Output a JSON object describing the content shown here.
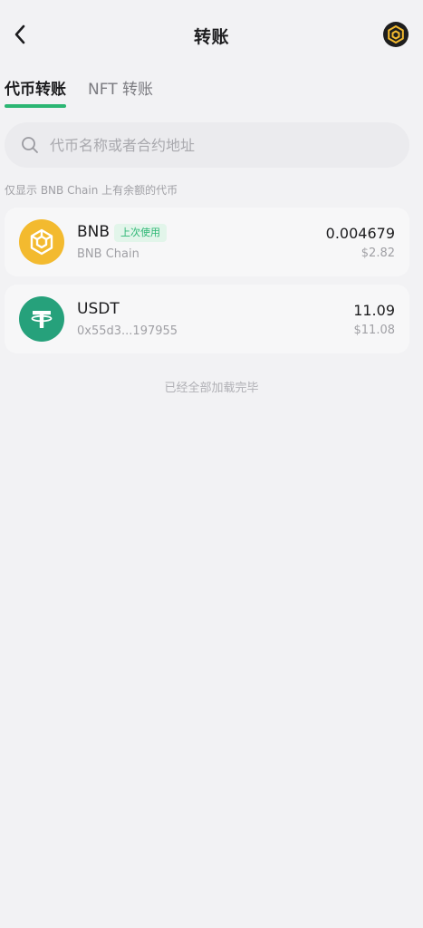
{
  "header": {
    "title": "转账",
    "back_icon": "chevron-left-icon",
    "chain_icon": "bnb-chain-icon"
  },
  "tabs": [
    {
      "label": "代币转账",
      "active": true
    },
    {
      "label": "NFT 转账",
      "active": false
    }
  ],
  "search": {
    "placeholder": "代币名称或者合约地址",
    "value": ""
  },
  "hint": "仅显示 BNB Chain 上有余额的代币",
  "tokens": [
    {
      "symbol": "BNB",
      "badge": "上次使用",
      "subtitle": "BNB Chain",
      "amount": "0.004679",
      "usd": "$2.82",
      "icon_color": "#f3ba2f"
    },
    {
      "symbol": "USDT",
      "subtitle": "0x55d3...197955",
      "amount": "11.09",
      "usd": "$11.08",
      "icon_color": "#26a17b"
    }
  ],
  "footer_note": "已经全部加载完毕",
  "colors": {
    "accent": "#2bb673",
    "background": "#f2f2f4"
  }
}
